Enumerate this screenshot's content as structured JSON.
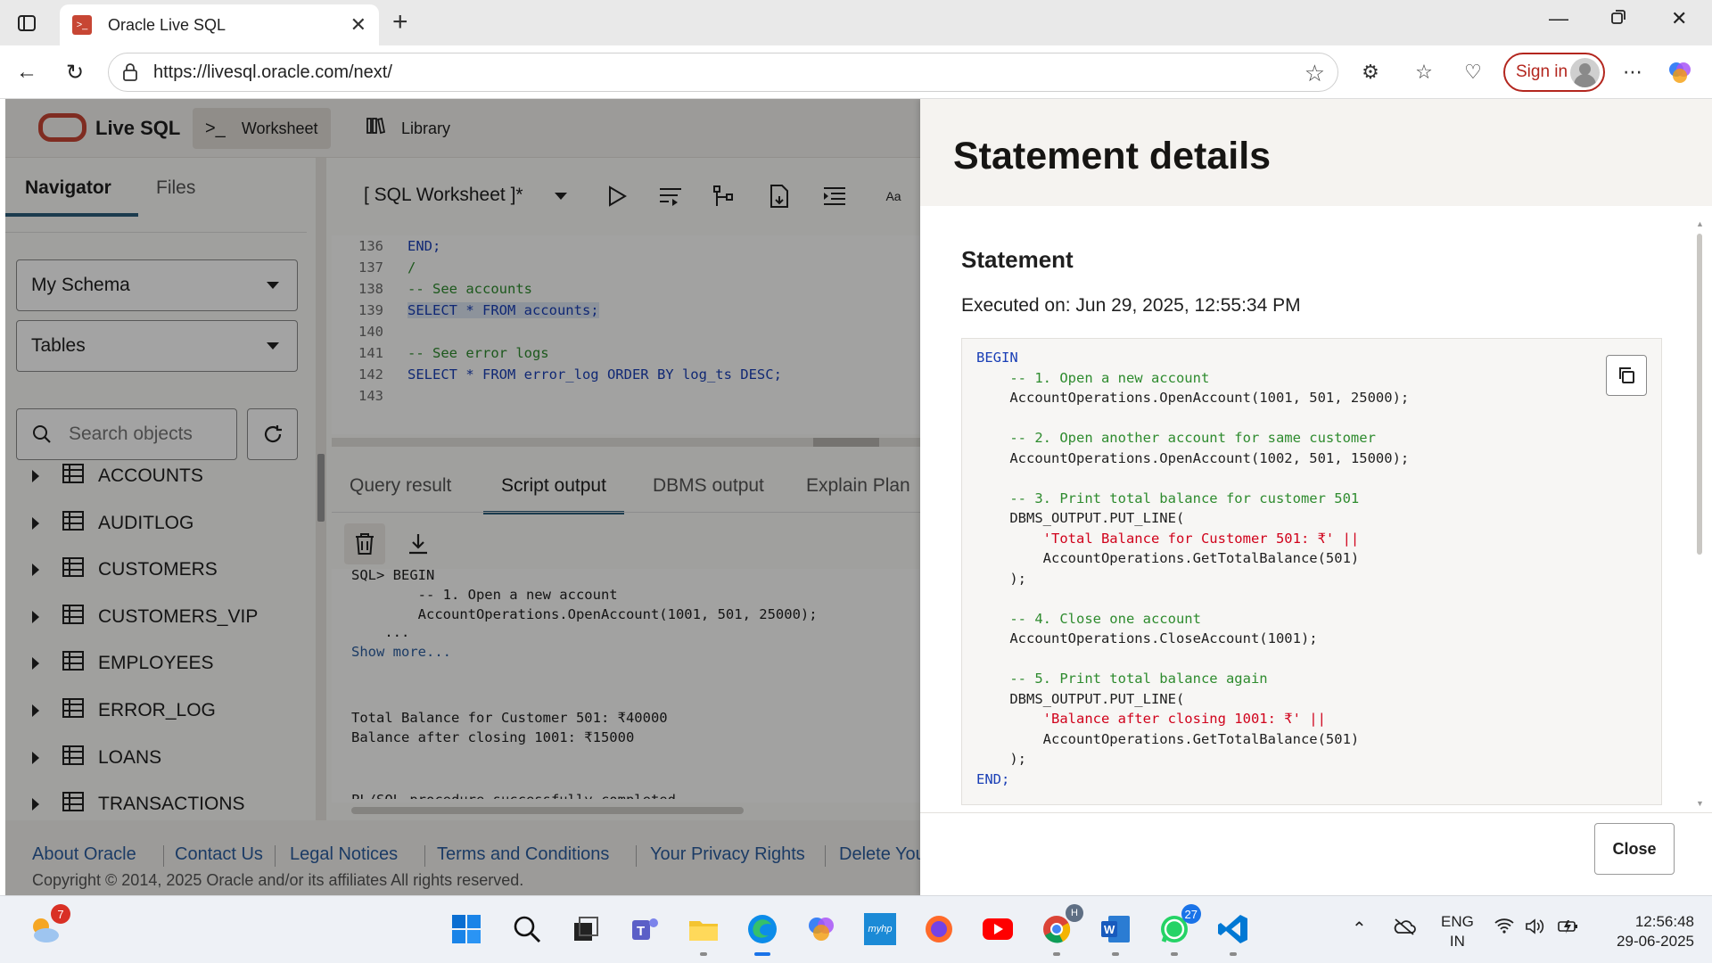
{
  "browser": {
    "tab_title": "Oracle Live SQL",
    "url": "https://livesql.oracle.com/next/",
    "signin_label": "Sign in"
  },
  "app": {
    "brand": "Live SQL",
    "tabs": [
      {
        "label": "Worksheet",
        "icon": "terminal-icon"
      },
      {
        "label": "Library",
        "icon": "library-icon"
      }
    ],
    "left_tabs": [
      "Navigator",
      "Files"
    ],
    "schema_select": "My Schema",
    "object_type_select": "Tables",
    "search_placeholder": "Search objects",
    "tables": [
      "ACCOUNTS",
      "AUDITLOG",
      "CUSTOMERS",
      "CUSTOMERS_VIP",
      "EMPLOYEES",
      "ERROR_LOG",
      "LOANS",
      "TRANSACTIONS"
    ],
    "worksheet_title": "[ SQL Worksheet ]*",
    "font_toggle": "Aa",
    "editor_lines": [
      {
        "n": "136",
        "text": "END;"
      },
      {
        "n": "137",
        "text": "/"
      },
      {
        "n": "138",
        "text": "-- See accounts"
      },
      {
        "n": "139",
        "text": "SELECT * FROM accounts;"
      },
      {
        "n": "140",
        "text": ""
      },
      {
        "n": "141",
        "text": "-- See error logs"
      },
      {
        "n": "142",
        "text": "SELECT * FROM error_log ORDER BY log_ts DESC;"
      },
      {
        "n": "143",
        "text": ""
      }
    ],
    "output_tabs": [
      "Query result",
      "Script output",
      "DBMS output",
      "Explain Plan"
    ],
    "output_lines": [
      "SQL> BEGIN",
      "        -- 1. Open a new account",
      "        AccountOperations.OpenAccount(1001, 501, 25000);",
      "    ...",
      "Show more...",
      "Total Balance for Customer 501: ₹40000",
      "Balance after closing 1001: ₹15000",
      "PL/SQL procedure successfully completed."
    ],
    "footer_links": [
      "About Oracle",
      "Contact Us",
      "Legal Notices",
      "Terms and Conditions",
      "Your Privacy Rights",
      "Delete Your Cookies"
    ],
    "copyright": "Copyright © 2014, 2025 Oracle and/or its affiliates All rights reserved."
  },
  "drawer": {
    "title": "Statement details",
    "section_title": "Statement",
    "executed_on": "Executed on: Jun 29, 2025, 12:55:34 PM",
    "close_label": "Close",
    "code_lines": [
      "BEGIN",
      "    -- 1. Open a new account",
      "    AccountOperations.OpenAccount(1001, 501, 25000);",
      "",
      "    -- 2. Open another account for same customer",
      "    AccountOperations.OpenAccount(1002, 501, 15000);",
      "",
      "    -- 3. Print total balance for customer 501",
      "    DBMS_OUTPUT.PUT_LINE(",
      "        'Total Balance for Customer 501: ₹' ||",
      "        AccountOperations.GetTotalBalance(501)",
      "    );",
      "",
      "    -- 4. Close one account",
      "    AccountOperations.CloseAccount(1001);",
      "",
      "    -- 5. Print total balance again",
      "    DBMS_OUTPUT.PUT_LINE(",
      "        'Balance after closing 1001: ₹' ||",
      "        AccountOperations.GetTotalBalance(501)",
      "    );",
      "END;"
    ]
  },
  "taskbar": {
    "weather_badge": "7",
    "whatsapp_badge": "27",
    "chrome_badge": "H",
    "myhp_label": "myhp",
    "lang_line1": "ENG",
    "lang_line2": "IN",
    "time": "12:56:48",
    "date": "29-06-2025"
  },
  "colors": {
    "oracle_red": "#c74634",
    "accent_tab": "#2b5d7a",
    "link": "#2b5d9e",
    "keyword": "#1a3fb6",
    "comment": "#2e8b2e",
    "string": "#d0021b",
    "number": "#0e7c66"
  }
}
